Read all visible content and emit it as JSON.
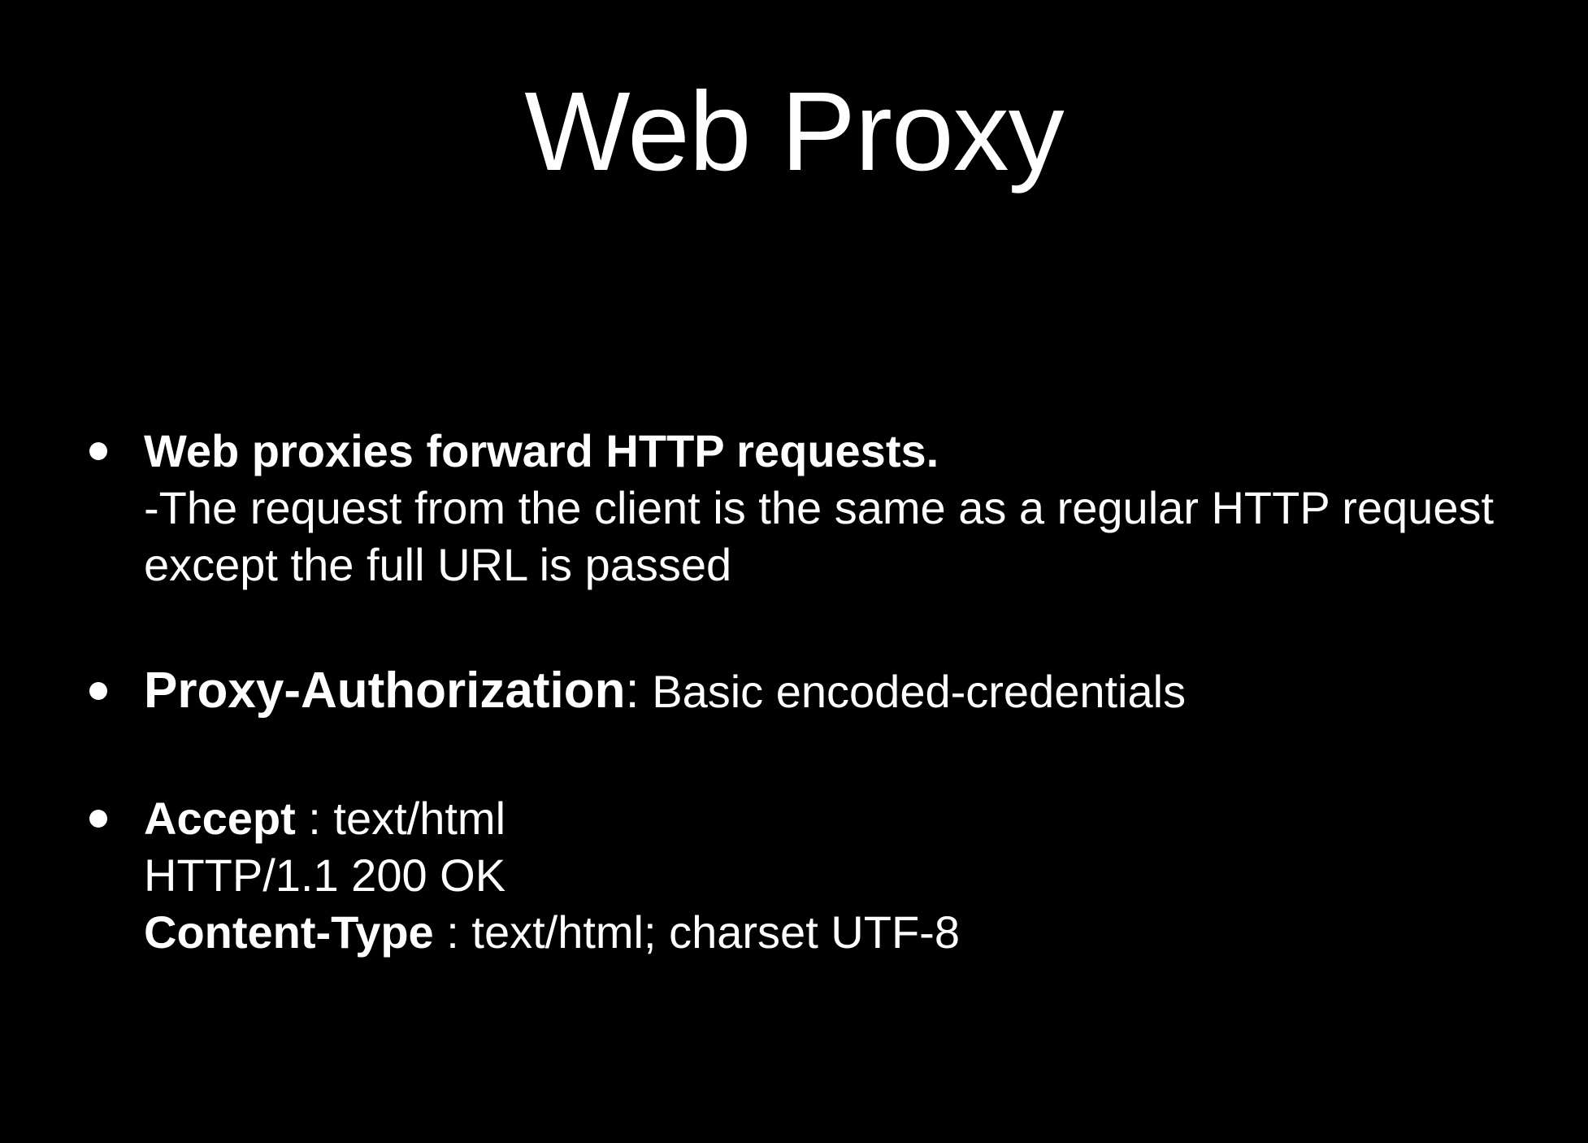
{
  "slide": {
    "title": "Web Proxy",
    "bullets": [
      {
        "heading": "Web proxies forward HTTP requests.",
        "lines": [
          "-The request from the client is the same as a regular HTTP request",
          "except the full URL is passed"
        ]
      },
      {
        "label": "Proxy-Authorization",
        "separator": ":",
        "value": " Basic encoded-credentials"
      },
      {
        "lines": [
          {
            "label": "Accept",
            "value": " : text/html"
          },
          {
            "value": "HTTP/1.1 200 OK"
          },
          {
            "label": "Content-Type",
            "value": " : text/html; charset UTF-8"
          }
        ]
      }
    ]
  }
}
